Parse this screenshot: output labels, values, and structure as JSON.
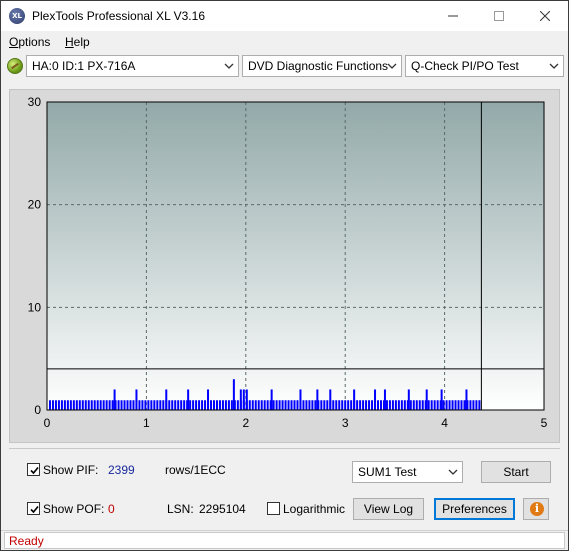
{
  "window": {
    "title": "PlexTools Professional XL V3.16",
    "icon_label": "XL",
    "controls": [
      "minimize-icon",
      "maximize-icon",
      "close-icon"
    ]
  },
  "menu": {
    "items": [
      {
        "label": "Options",
        "accel": "O",
        "rest": "ptions"
      },
      {
        "label": "Help",
        "accel": "H",
        "rest": "elp"
      }
    ]
  },
  "toolbar": {
    "drive": "HA:0 ID:1  PX-716A",
    "function": "DVD Diagnostic Functions",
    "test": "Q-Check PI/PO Test"
  },
  "chart_data": {
    "type": "bar",
    "xlim": [
      0,
      5
    ],
    "ylim": [
      0,
      30
    ],
    "x_ticks": [
      "0",
      "1",
      "2",
      "3",
      "4",
      "5"
    ],
    "y_ticks": [
      "0",
      "10",
      "20",
      "30"
    ],
    "grid": true,
    "scan_end_x": 4.37,
    "threshold_y": 4,
    "series": [
      {
        "color": "#0000ff",
        "x": [
          0.03,
          0.06,
          0.09,
          0.12,
          0.15,
          0.18,
          0.21,
          0.24,
          0.27,
          0.3,
          0.33,
          0.36,
          0.39,
          0.42,
          0.45,
          0.48,
          0.51,
          0.54,
          0.57,
          0.6,
          0.63,
          0.66,
          0.69,
          0.72,
          0.75,
          0.78,
          0.81,
          0.84,
          0.87,
          0.9,
          0.93,
          0.96,
          0.99,
          1.02,
          1.05,
          1.08,
          1.11,
          1.14,
          1.17,
          1.2,
          1.23,
          1.26,
          1.29,
          1.32,
          1.35,
          1.38,
          1.41,
          1.44,
          1.47,
          1.5,
          1.53,
          1.56,
          1.59,
          1.62,
          1.65,
          1.68,
          1.71,
          1.74,
          1.77,
          1.8,
          1.83,
          1.86,
          1.89,
          1.92,
          1.95,
          1.98,
          2.01,
          2.04,
          2.07,
          2.1,
          2.13,
          2.16,
          2.19,
          2.22,
          2.25,
          2.28,
          2.31,
          2.34,
          2.37,
          2.4,
          2.43,
          2.46,
          2.49,
          2.52,
          2.55,
          2.58,
          2.61,
          2.64,
          2.67,
          2.7,
          2.73,
          2.76,
          2.79,
          2.82,
          2.85,
          2.88,
          2.91,
          2.94,
          2.97,
          3.0,
          3.03,
          3.06,
          3.09,
          3.12,
          3.15,
          3.18,
          3.21,
          3.24,
          3.27,
          3.3,
          3.33,
          3.36,
          3.39,
          3.42,
          3.45,
          3.48,
          3.51,
          3.54,
          3.57,
          3.6,
          3.63,
          3.66,
          3.69,
          3.72,
          3.75,
          3.78,
          3.81,
          3.84,
          3.87,
          3.9,
          3.93,
          3.96,
          3.99,
          4.02,
          4.05,
          4.08,
          4.11,
          4.14,
          4.17,
          4.2,
          4.23,
          4.26,
          4.29,
          4.32,
          4.35
        ],
        "values": [
          1,
          1,
          1,
          1,
          1,
          1,
          1,
          1,
          1,
          1,
          1,
          1,
          1,
          1,
          1,
          1,
          1,
          1,
          1,
          1,
          1,
          1,
          1,
          1,
          1,
          1,
          1,
          1,
          1,
          1,
          1,
          1,
          1,
          1,
          1,
          1,
          1,
          1,
          1,
          1,
          1,
          1,
          1,
          1,
          1,
          1,
          1,
          1,
          1,
          1,
          1,
          1,
          1,
          1,
          1,
          1,
          1,
          1,
          1,
          1,
          1,
          1,
          1,
          1,
          1,
          1,
          1,
          1,
          1,
          1,
          1,
          1,
          1,
          1,
          1,
          1,
          1,
          1,
          1,
          1,
          1,
          1,
          1,
          1,
          1,
          1,
          1,
          1,
          1,
          1,
          1,
          1,
          1,
          1,
          1,
          1,
          1,
          1,
          1,
          1,
          1,
          1,
          1,
          1,
          1,
          1,
          1,
          1,
          1,
          1,
          1,
          1,
          1,
          1,
          1,
          1,
          1,
          1,
          1,
          1,
          1,
          1,
          1,
          1,
          1,
          1,
          1,
          1,
          1,
          1,
          1,
          1,
          1,
          1,
          1,
          1,
          1,
          1,
          1,
          1,
          1,
          1,
          1,
          1,
          1
        ]
      }
    ],
    "spikes": {
      "x": [
        0.68,
        0.9,
        1.2,
        1.42,
        1.62,
        1.88,
        1.95,
        1.98,
        2.01,
        2.26,
        2.55,
        2.72,
        2.85,
        3.09,
        3.3,
        3.4,
        3.64,
        3.82,
        3.97,
        4.22
      ],
      "values": [
        2,
        2,
        2,
        2,
        2,
        3,
        2,
        2,
        2,
        2,
        2,
        2,
        2,
        2,
        2,
        2,
        2,
        2,
        2,
        2
      ]
    }
  },
  "controls": {
    "show_pif_label": "Show PIF:",
    "show_pif_accel": "I",
    "pif_value": "2399",
    "pif_unit": "rows/1ECC",
    "show_pof_label": "Show POF:",
    "show_pof_accel": "F",
    "pof_value": "0",
    "lsn_label": "LSN:",
    "lsn_value": "2295104",
    "logarithmic_label": "Logarithmic",
    "test_select": "SUM1 Test",
    "start_button": "Start",
    "view_log_button": "View Log",
    "preferences_button": "Preferences",
    "info_glyph": "i"
  },
  "status": {
    "text": "Ready"
  }
}
